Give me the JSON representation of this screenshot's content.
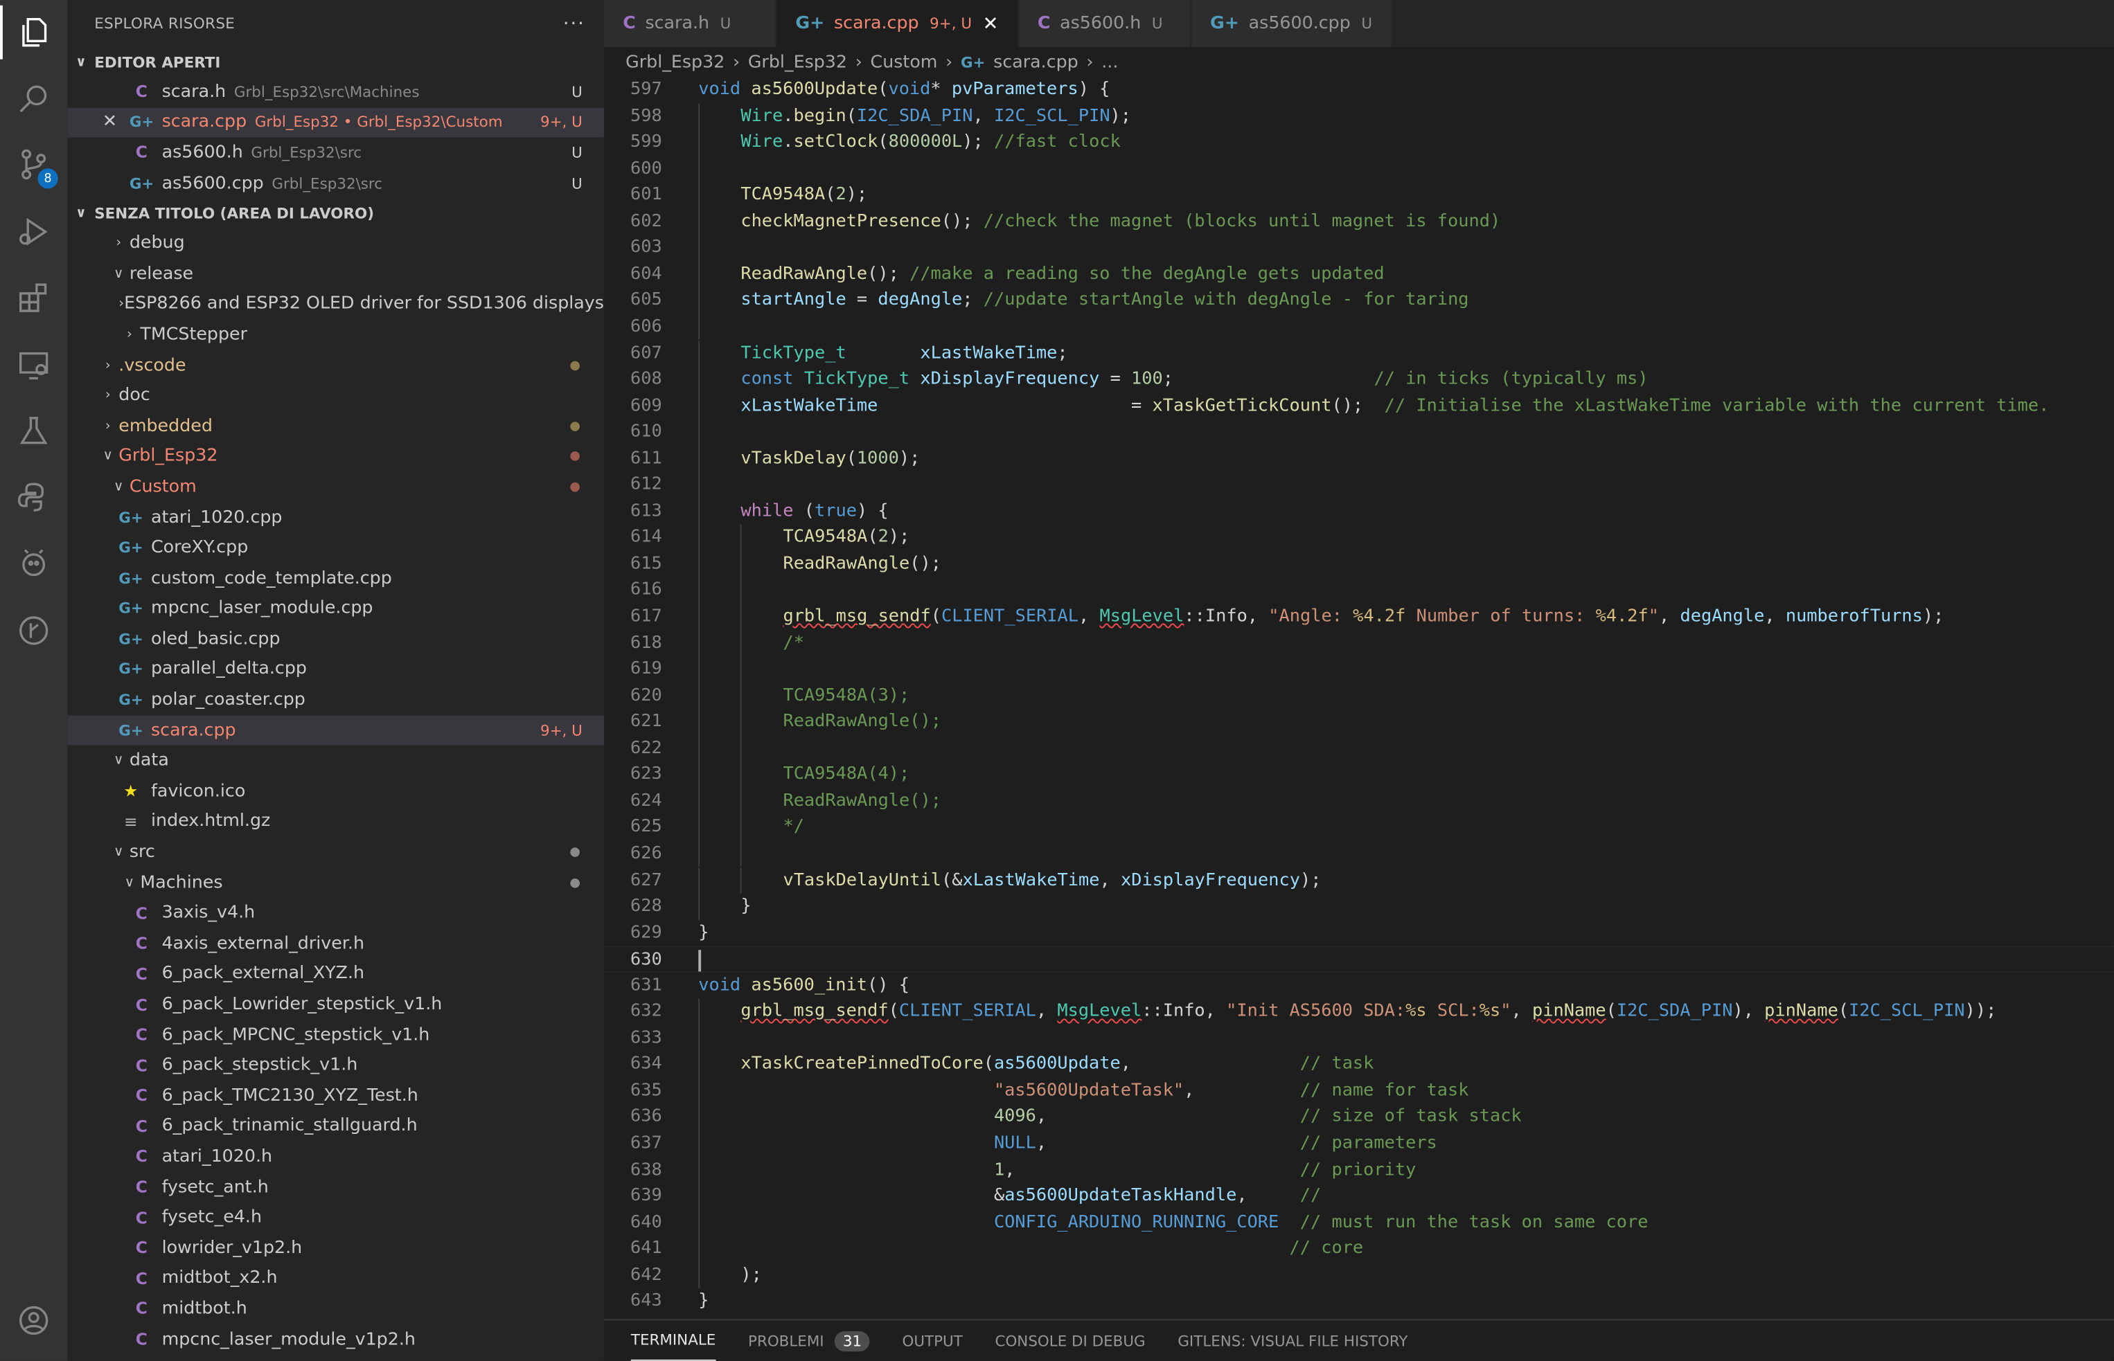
{
  "activity": [
    "explorer-icon",
    "search-icon",
    "source-control-icon",
    "run-debug-icon",
    "extensions-icon",
    "remote-explorer-icon",
    "testing-icon",
    "python-icon",
    "platformio-icon",
    "gitlens-icon",
    "account-icon"
  ],
  "scm_badge": "8",
  "sidebar": {
    "title": "ESPLORA RISORSE",
    "more": "···",
    "open_editors_title": "EDITOR APERTI",
    "open_editors": [
      {
        "icon": "C",
        "name": "scara.h",
        "path": "Grbl_Esp32\\src\\Machines",
        "status": "U"
      },
      {
        "icon": "G",
        "name": "scara.cpp",
        "path": "Grbl_Esp32 • Grbl_Esp32\\Custom",
        "status": "9+, U"
      },
      {
        "icon": "C",
        "name": "as5600.h",
        "path": "Grbl_Esp32\\src",
        "status": "U"
      },
      {
        "icon": "G",
        "name": "as5600.cpp",
        "path": "Grbl_Esp32\\src",
        "status": "U"
      }
    ],
    "workspace_title": "SENZA TITOLO (AREA DI LAVORO)",
    "tree": [
      {
        "name": "debug",
        "depth": 2,
        "kind": "folder-closed"
      },
      {
        "name": "release",
        "depth": 2,
        "kind": "folder-open"
      },
      {
        "name": "ESP8266 and ESP32 OLED driver for SSD1306 displays",
        "depth": 3,
        "kind": "folder-closed"
      },
      {
        "name": "TMCStepper",
        "depth": 3,
        "kind": "folder-closed"
      },
      {
        "name": ".vscode",
        "depth": 1,
        "kind": "folder-closed",
        "color": "mod",
        "dot": "#8c7b4a"
      },
      {
        "name": "doc",
        "depth": 1,
        "kind": "folder-closed"
      },
      {
        "name": "embedded",
        "depth": 1,
        "kind": "folder-closed",
        "color": "mod",
        "dot": "#8c7b4a"
      },
      {
        "name": "Grbl_Esp32",
        "depth": 1,
        "kind": "folder-open",
        "color": "err",
        "dot": "#9c5a4e"
      },
      {
        "name": "Custom",
        "depth": 2,
        "kind": "folder-open",
        "color": "err",
        "dot": "#9c5a4e"
      },
      {
        "name": "atari_1020.cpp",
        "depth": 3,
        "kind": "cpp"
      },
      {
        "name": "CoreXY.cpp",
        "depth": 3,
        "kind": "cpp"
      },
      {
        "name": "custom_code_template.cpp",
        "depth": 3,
        "kind": "cpp"
      },
      {
        "name": "mpcnc_laser_module.cpp",
        "depth": 3,
        "kind": "cpp"
      },
      {
        "name": "oled_basic.cpp",
        "depth": 3,
        "kind": "cpp"
      },
      {
        "name": "parallel_delta.cpp",
        "depth": 3,
        "kind": "cpp"
      },
      {
        "name": "polar_coaster.cpp",
        "depth": 3,
        "kind": "cpp"
      },
      {
        "name": "scara.cpp",
        "depth": 3,
        "kind": "cpp",
        "color": "err",
        "status": "9+, U",
        "selected": true
      },
      {
        "name": "data",
        "depth": 2,
        "kind": "folder-open"
      },
      {
        "name": "favicon.ico",
        "depth": 3,
        "kind": "star"
      },
      {
        "name": "index.html.gz",
        "depth": 3,
        "kind": "lines"
      },
      {
        "name": "src",
        "depth": 2,
        "kind": "folder-open",
        "dot": "#8a8a8a"
      },
      {
        "name": "Machines",
        "depth": 3,
        "kind": "folder-open",
        "dot": "#8a8a8a"
      },
      {
        "name": "3axis_v4.h",
        "depth": 4,
        "kind": "c"
      },
      {
        "name": "4axis_external_driver.h",
        "depth": 4,
        "kind": "c"
      },
      {
        "name": "6_pack_external_XYZ.h",
        "depth": 4,
        "kind": "c"
      },
      {
        "name": "6_pack_Lowrider_stepstick_v1.h",
        "depth": 4,
        "kind": "c"
      },
      {
        "name": "6_pack_MPCNC_stepstick_v1.h",
        "depth": 4,
        "kind": "c"
      },
      {
        "name": "6_pack_stepstick_v1.h",
        "depth": 4,
        "kind": "c"
      },
      {
        "name": "6_pack_TMC2130_XYZ_Test.h",
        "depth": 4,
        "kind": "c"
      },
      {
        "name": "6_pack_trinamic_stallguard.h",
        "depth": 4,
        "kind": "c"
      },
      {
        "name": "atari_1020.h",
        "depth": 4,
        "kind": "c"
      },
      {
        "name": "fysetc_ant.h",
        "depth": 4,
        "kind": "c"
      },
      {
        "name": "fysetc_e4.h",
        "depth": 4,
        "kind": "c"
      },
      {
        "name": "lowrider_v1p2.h",
        "depth": 4,
        "kind": "c"
      },
      {
        "name": "midtbot_x2.h",
        "depth": 4,
        "kind": "c"
      },
      {
        "name": "midtbot.h",
        "depth": 4,
        "kind": "c"
      },
      {
        "name": "mpcnc_laser_module_v1p2.h",
        "depth": 4,
        "kind": "c"
      }
    ]
  },
  "tabs": [
    {
      "icon": "C",
      "name": "scara.h",
      "status": "U",
      "active": false
    },
    {
      "icon": "G",
      "name": "scara.cpp",
      "status": "9+, U",
      "active": true,
      "close": "✕"
    },
    {
      "icon": "C",
      "name": "as5600.h",
      "status": "U",
      "active": false
    },
    {
      "icon": "G",
      "name": "as5600.cpp",
      "status": "U",
      "active": false
    }
  ],
  "breadcrumb": [
    "Grbl_Esp32",
    "Grbl_Esp32",
    "Custom",
    "scara.cpp",
    "..."
  ],
  "editor": {
    "current_line": 630,
    "lines": [
      {
        "n": 597,
        "indent": 0,
        "t": [
          [
            "kw",
            "void"
          ],
          [
            "p",
            " "
          ],
          [
            "fn",
            "as5600Update"
          ],
          [
            "p",
            "("
          ],
          [
            "kw",
            "void"
          ],
          [
            "p",
            "* "
          ],
          [
            "vr",
            "pvParameters"
          ],
          [
            "p",
            ") {"
          ]
        ]
      },
      {
        "n": 598,
        "indent": 1,
        "t": [
          [
            "ty",
            "Wire"
          ],
          [
            "p",
            "."
          ],
          [
            "fn",
            "begin"
          ],
          [
            "p",
            "("
          ],
          [
            "mac",
            "I2C_SDA_PIN"
          ],
          [
            "p",
            ", "
          ],
          [
            "mac",
            "I2C_SCL_PIN"
          ],
          [
            "p",
            ");"
          ]
        ]
      },
      {
        "n": 599,
        "indent": 1,
        "t": [
          [
            "ty",
            "Wire"
          ],
          [
            "p",
            "."
          ],
          [
            "fn",
            "setClock"
          ],
          [
            "p",
            "("
          ],
          [
            "nm",
            "800000L"
          ],
          [
            "p",
            "); "
          ],
          [
            "cm",
            "//fast clock"
          ]
        ]
      },
      {
        "n": 600,
        "indent": 1,
        "t": []
      },
      {
        "n": 601,
        "indent": 1,
        "t": [
          [
            "fn",
            "TCA9548A"
          ],
          [
            "p",
            "("
          ],
          [
            "nm",
            "2"
          ],
          [
            "p",
            ");"
          ]
        ]
      },
      {
        "n": 602,
        "indent": 1,
        "t": [
          [
            "fn",
            "checkMagnetPresence"
          ],
          [
            "p",
            "(); "
          ],
          [
            "cm",
            "//check the magnet (blocks until magnet is found)"
          ]
        ]
      },
      {
        "n": 603,
        "indent": 1,
        "t": []
      },
      {
        "n": 604,
        "indent": 1,
        "t": [
          [
            "fn",
            "ReadRawAngle"
          ],
          [
            "p",
            "(); "
          ],
          [
            "cm",
            "//make a reading so the degAngle gets updated"
          ]
        ]
      },
      {
        "n": 605,
        "indent": 1,
        "t": [
          [
            "vr",
            "startAngle"
          ],
          [
            "p",
            " = "
          ],
          [
            "vr",
            "degAngle"
          ],
          [
            "p",
            "; "
          ],
          [
            "cm",
            "//update startAngle with degAngle - for taring"
          ]
        ]
      },
      {
        "n": 606,
        "indent": 1,
        "t": []
      },
      {
        "n": 607,
        "indent": 1,
        "t": [
          [
            "ty",
            "TickType_t"
          ],
          [
            "p",
            "       "
          ],
          [
            "vr",
            "xLastWakeTime"
          ],
          [
            "p",
            ";"
          ]
        ]
      },
      {
        "n": 608,
        "indent": 1,
        "t": [
          [
            "kw",
            "const"
          ],
          [
            "p",
            " "
          ],
          [
            "ty",
            "TickType_t"
          ],
          [
            "p",
            " "
          ],
          [
            "vr",
            "xDisplayFrequency"
          ],
          [
            "p",
            " = "
          ],
          [
            "nm",
            "100"
          ],
          [
            "p",
            ";                   "
          ],
          [
            "cm",
            "// in ticks (typically ms)"
          ]
        ]
      },
      {
        "n": 609,
        "indent": 1,
        "t": [
          [
            "vr",
            "xLastWakeTime"
          ],
          [
            "p",
            "                        = "
          ],
          [
            "fn",
            "xTaskGetTickCount"
          ],
          [
            "p",
            "();  "
          ],
          [
            "cm",
            "// Initialise the xLastWakeTime variable with the current time."
          ]
        ]
      },
      {
        "n": 610,
        "indent": 1,
        "t": []
      },
      {
        "n": 611,
        "indent": 1,
        "t": [
          [
            "fn",
            "vTaskDelay"
          ],
          [
            "p",
            "("
          ],
          [
            "nm",
            "1000"
          ],
          [
            "p",
            ");"
          ]
        ]
      },
      {
        "n": 612,
        "indent": 1,
        "t": []
      },
      {
        "n": 613,
        "indent": 1,
        "t": [
          [
            "kw2",
            "while"
          ],
          [
            "p",
            " ("
          ],
          [
            "kw",
            "true"
          ],
          [
            "p",
            ") {"
          ]
        ]
      },
      {
        "n": 614,
        "indent": 2,
        "t": [
          [
            "fn",
            "TCA9548A"
          ],
          [
            "p",
            "("
          ],
          [
            "nm",
            "2"
          ],
          [
            "p",
            ");"
          ]
        ]
      },
      {
        "n": 615,
        "indent": 2,
        "t": [
          [
            "fn",
            "ReadRawAngle"
          ],
          [
            "p",
            "();"
          ]
        ]
      },
      {
        "n": 616,
        "indent": 2,
        "t": []
      },
      {
        "n": 617,
        "indent": 2,
        "t": [
          [
            "fnsq",
            "grbl_msg_sendf"
          ],
          [
            "p",
            "("
          ],
          [
            "mac",
            "CLIENT_SERIAL"
          ],
          [
            "p",
            ", "
          ],
          [
            "tysq",
            "MsgLevel"
          ],
          [
            "p",
            "::Info, "
          ],
          [
            "st",
            "\"Angle: "
          ],
          [
            "esc",
            "%4.2f"
          ],
          [
            "st",
            " Number of turns: "
          ],
          [
            "esc",
            "%4.2f"
          ],
          [
            "st",
            "\""
          ],
          [
            "p",
            ", "
          ],
          [
            "vr",
            "degAngle"
          ],
          [
            "p",
            ", "
          ],
          [
            "vr",
            "numberofTurns"
          ],
          [
            "p",
            ");"
          ]
        ]
      },
      {
        "n": 618,
        "indent": 2,
        "t": [
          [
            "cm",
            "/*"
          ]
        ]
      },
      {
        "n": 619,
        "indent": 2,
        "t": []
      },
      {
        "n": 620,
        "indent": 2,
        "t": [
          [
            "cm",
            "TCA9548A(3);"
          ]
        ]
      },
      {
        "n": 621,
        "indent": 2,
        "t": [
          [
            "cm",
            "ReadRawAngle();"
          ]
        ]
      },
      {
        "n": 622,
        "indent": 2,
        "t": []
      },
      {
        "n": 623,
        "indent": 2,
        "t": [
          [
            "cm",
            "TCA9548A(4);"
          ]
        ]
      },
      {
        "n": 624,
        "indent": 2,
        "t": [
          [
            "cm",
            "ReadRawAngle();"
          ]
        ]
      },
      {
        "n": 625,
        "indent": 2,
        "t": [
          [
            "cm",
            "*/"
          ]
        ]
      },
      {
        "n": 626,
        "indent": 2,
        "t": []
      },
      {
        "n": 627,
        "indent": 2,
        "t": [
          [
            "fn",
            "vTaskDelayUntil"
          ],
          [
            "p",
            "(&"
          ],
          [
            "vr",
            "xLastWakeTime"
          ],
          [
            "p",
            ", "
          ],
          [
            "vr",
            "xDisplayFrequency"
          ],
          [
            "p",
            ");"
          ]
        ]
      },
      {
        "n": 628,
        "indent": 1,
        "t": [
          [
            "p",
            "}"
          ]
        ]
      },
      {
        "n": 629,
        "indent": 0,
        "t": [
          [
            "p",
            "}"
          ]
        ]
      },
      {
        "n": 630,
        "indent": 0,
        "t": []
      },
      {
        "n": 631,
        "indent": 0,
        "t": [
          [
            "kw",
            "void"
          ],
          [
            "p",
            " "
          ],
          [
            "fn",
            "as5600_init"
          ],
          [
            "p",
            "() {"
          ]
        ]
      },
      {
        "n": 632,
        "indent": 1,
        "t": [
          [
            "fnsq",
            "grbl_msg_sendf"
          ],
          [
            "p",
            "("
          ],
          [
            "mac",
            "CLIENT_SERIAL"
          ],
          [
            "p",
            ", "
          ],
          [
            "tysq",
            "MsgLevel"
          ],
          [
            "p",
            "::Info, "
          ],
          [
            "st",
            "\"Init AS5600 SDA:"
          ],
          [
            "esc",
            "%s"
          ],
          [
            "st",
            " SCL:"
          ],
          [
            "esc",
            "%s"
          ],
          [
            "st",
            "\""
          ],
          [
            "p",
            ", "
          ],
          [
            "fnsq",
            "pinName"
          ],
          [
            "p",
            "("
          ],
          [
            "mac",
            "I2C_SDA_PIN"
          ],
          [
            "p",
            "), "
          ],
          [
            "fnsq",
            "pinName"
          ],
          [
            "p",
            "("
          ],
          [
            "mac",
            "I2C_SCL_PIN"
          ],
          [
            "p",
            "));"
          ]
        ]
      },
      {
        "n": 633,
        "indent": 1,
        "t": []
      },
      {
        "n": 634,
        "indent": 1,
        "t": [
          [
            "fn",
            "xTaskCreatePinnedToCore"
          ],
          [
            "p",
            "("
          ],
          [
            "vr",
            "as5600Update"
          ],
          [
            "p",
            ",                "
          ],
          [
            "cm",
            "// task"
          ]
        ]
      },
      {
        "n": 635,
        "indent": 1,
        "t": [
          [
            "p",
            "                        "
          ],
          [
            "st",
            "\"as5600UpdateTask\""
          ],
          [
            "p",
            ",          "
          ],
          [
            "cm",
            "// name for task"
          ]
        ]
      },
      {
        "n": 636,
        "indent": 1,
        "t": [
          [
            "p",
            "                        "
          ],
          [
            "nm",
            "4096"
          ],
          [
            "p",
            ",                        "
          ],
          [
            "cm",
            "// size of task stack"
          ]
        ]
      },
      {
        "n": 637,
        "indent": 1,
        "t": [
          [
            "p",
            "                        "
          ],
          [
            "mac",
            "NULL"
          ],
          [
            "p",
            ",                        "
          ],
          [
            "cm",
            "// parameters"
          ]
        ]
      },
      {
        "n": 638,
        "indent": 1,
        "t": [
          [
            "p",
            "                        "
          ],
          [
            "nm",
            "1"
          ],
          [
            "p",
            ",                           "
          ],
          [
            "cm",
            "// priority"
          ]
        ]
      },
      {
        "n": 639,
        "indent": 1,
        "t": [
          [
            "p",
            "                        &"
          ],
          [
            "vr",
            "as5600UpdateTaskHandle"
          ],
          [
            "p",
            ",     "
          ],
          [
            "cm",
            "//"
          ]
        ]
      },
      {
        "n": 640,
        "indent": 1,
        "t": [
          [
            "p",
            "                        "
          ],
          [
            "mac",
            "CONFIG_ARDUINO_RUNNING_CORE"
          ],
          [
            "p",
            "  "
          ],
          [
            "cm",
            "// must run the task on same core"
          ]
        ]
      },
      {
        "n": 641,
        "indent": 1,
        "t": [
          [
            "p",
            "                                                    "
          ],
          [
            "cm",
            "// core"
          ]
        ]
      },
      {
        "n": 642,
        "indent": 1,
        "t": [
          [
            "p",
            ");"
          ]
        ]
      },
      {
        "n": 643,
        "indent": 0,
        "t": [
          [
            "p",
            "}"
          ]
        ]
      }
    ]
  },
  "panel": {
    "tabs": [
      "TERMINALE",
      "PROBLEMI",
      "OUTPUT",
      "CONSOLE DI DEBUG",
      "GITLENS: VISUAL FILE HISTORY"
    ],
    "problems_count": "31"
  }
}
